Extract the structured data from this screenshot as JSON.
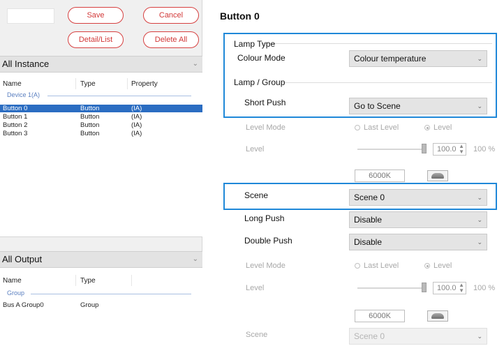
{
  "toolbar": {
    "save_label": "Save",
    "cancel_label": "Cancel",
    "detail_list_label": "Detail/List",
    "delete_all_label": "Delete All"
  },
  "instance_panel": {
    "filter": "All Instance",
    "columns": [
      "Name",
      "Type",
      "Property"
    ],
    "group_label": "Device 1(A)",
    "rows": [
      {
        "name": "Button 0",
        "type": "Button",
        "property": "(IA)",
        "selected": true
      },
      {
        "name": "Button 1",
        "type": "Button",
        "property": "(IA)",
        "selected": false
      },
      {
        "name": "Button 2",
        "type": "Button",
        "property": "(IA)",
        "selected": false
      },
      {
        "name": "Button 3",
        "type": "Button",
        "property": "(IA)",
        "selected": false
      }
    ]
  },
  "output_panel": {
    "filter": "All Output",
    "columns": [
      "Name",
      "Type"
    ],
    "group_label": "Group",
    "rows": [
      {
        "name": "Bus A Group0",
        "type": "Group"
      }
    ]
  },
  "detail": {
    "title": "Button 0",
    "lamp_type_label": "Lamp Type",
    "colour_mode_label": "Colour Mode",
    "colour_mode_value": "Colour temperature",
    "lamp_group_label": "Lamp / Group",
    "short_push": {
      "label": "Short Push",
      "value": "Go to Scene",
      "level_mode_label": "Level Mode",
      "last_level_label": "Last Level",
      "level_option_label": "Level",
      "level_label": "Level",
      "level_value": "100.0",
      "level_percent": "100 %",
      "colour_temp": "6000K",
      "scene_label": "Scene",
      "scene_value": "Scene 0"
    },
    "long_push": {
      "label": "Long Push",
      "value": "Disable"
    },
    "double_push": {
      "label": "Double Push",
      "value": "Disable",
      "level_mode_label": "Level Mode",
      "last_level_label": "Last Level",
      "level_option_label": "Level",
      "level_label": "Level",
      "level_value": "100.0",
      "level_percent": "100 %",
      "colour_temp": "6000K",
      "scene_label": "Scene",
      "scene_value": "Scene 0"
    }
  },
  "colors": {
    "selection": "#2b6dc2",
    "highlight_border": "#1f88d8",
    "pill_red": "#d64040",
    "group_text": "#5a7fc0"
  }
}
